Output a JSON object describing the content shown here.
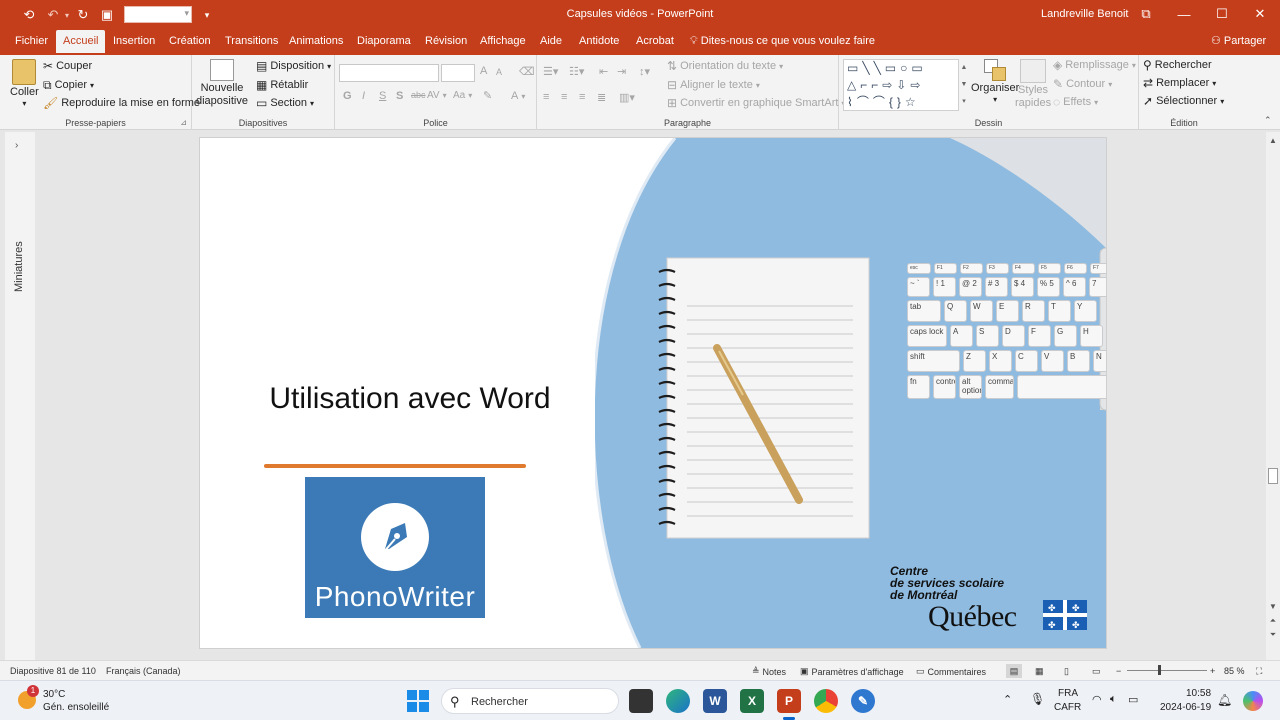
{
  "window": {
    "title": "Capsules vidéos  -  PowerPoint",
    "user": "Landreville Benoit"
  },
  "tabs": {
    "items": [
      "Fichier",
      "Accueil",
      "Insertion",
      "Création",
      "Transitions",
      "Animations",
      "Diaporama",
      "Révision",
      "Affichage",
      "Aide",
      "Antidote",
      "Acrobat"
    ],
    "active": "Accueil",
    "tell_me": "Dites-nous ce que vous voulez faire",
    "share": "Partager"
  },
  "ribbon": {
    "clipboard": {
      "label": "Presse-papiers",
      "paste": "Coller",
      "cut": "Couper",
      "copy": "Copier",
      "format_painter": "Reproduire la mise en forme"
    },
    "slides": {
      "label": "Diapositives",
      "new_slide_1": "Nouvelle",
      "new_slide_2": "diapositive",
      "layout": "Disposition",
      "reset": "Rétablir",
      "section": "Section"
    },
    "font": {
      "label": "Police",
      "bold": "G",
      "italic": "I",
      "underline": "S",
      "shadow": "S",
      "strike": "abc",
      "spacing": "AV",
      "case": "Aa",
      "color": "A",
      "grow": "A",
      "shrink": "A"
    },
    "paragraph": {
      "label": "Paragraphe",
      "text_direction": "Orientation du texte",
      "align_text": "Aligner le texte",
      "smartart": "Convertir en graphique SmartArt"
    },
    "drawing": {
      "label": "Dessin",
      "arrange": "Organiser",
      "quick_styles_1": "Styles",
      "quick_styles_2": "rapides",
      "fill": "Remplissage",
      "outline": "Contour",
      "effects": "Effets"
    },
    "editing": {
      "label": "Édition",
      "find": "Rechercher",
      "replace": "Remplacer",
      "select": "Sélectionner"
    }
  },
  "thumbnails": {
    "label": "Miniatures"
  },
  "slide": {
    "title": "Utilisation avec Word",
    "logo_text": "PhonoWriter",
    "org_line1": "Centre",
    "org_line2": "de services scolaire",
    "org_line3": "de Montréal",
    "quebec": "Québec",
    "keyboard_keys": {
      "esc": "esc",
      "tab": "tab",
      "caps": "caps lock",
      "shift": "shift",
      "fn": "fn",
      "control": "control",
      "option_1": "alt",
      "option_2": "option",
      "command": "command",
      "row_numbers": [
        "~",
        "!",
        "@",
        "#",
        "$",
        "%",
        "^"
      ],
      "row_numbers_digits": [
        "`",
        "1",
        "2",
        "3",
        "4",
        "5",
        "6",
        "7"
      ],
      "row_q": [
        "Q",
        "W",
        "E",
        "R",
        "T",
        "Y"
      ],
      "row_a": [
        "A",
        "S",
        "D",
        "F",
        "G",
        "H"
      ],
      "row_z": [
        "Z",
        "X",
        "C",
        "V",
        "B",
        "N"
      ],
      "fkeys": [
        "F1",
        "F2",
        "F3",
        "F4",
        "F5",
        "F6",
        "F7"
      ]
    }
  },
  "statusbar": {
    "slide_info": "Diapositive 81 de 110",
    "language": "Français (Canada)",
    "notes": "Notes",
    "display_settings": "Paramètres d'affichage",
    "comments": "Commentaires",
    "zoom": "85 %",
    "zoom_minus": "−",
    "zoom_plus": "+"
  },
  "taskbar": {
    "weather_temp": "30°C",
    "weather_desc": "Gén. ensoleillé",
    "weather_badge": "1",
    "search": "Rechercher",
    "lang_1": "FRA",
    "lang_2": "CAFR",
    "time": "10:58",
    "date": "2024-06-19",
    "apps": [
      "Word",
      "Excel",
      "PowerPoint"
    ]
  },
  "colors": {
    "accent": "#c43e1c",
    "slide_blue": "#8fbbe0",
    "logo_blue": "#3b7ab6",
    "rule_orange": "#e07a2e"
  }
}
